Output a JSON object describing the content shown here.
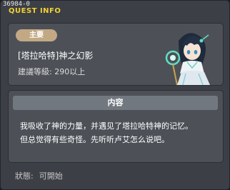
{
  "window": {
    "id": "36984-0",
    "title": "QUEST INFO"
  },
  "quest": {
    "badge": "主要",
    "name": "[塔拉哈特]神之幻影",
    "level_requirement": "建議等級: 290以上",
    "portrait_icon": "npc-portrait-icon"
  },
  "content": {
    "header": "内容",
    "line1": "我吸收了神的力量，并遇见了塔拉哈特神的记忆。",
    "line2": "但总觉得有些奇怪。先听听卢艾怎么说吧。"
  },
  "status": {
    "label": "狀態:",
    "value": "可開始"
  },
  "colors": {
    "title": "#f2d233",
    "badge": "#c2a984",
    "panel": "#4d5157",
    "window": "#3c3f45"
  }
}
